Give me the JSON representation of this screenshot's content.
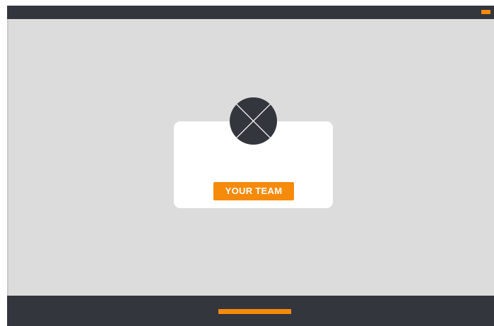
{
  "header": {
    "indicator_color": "#f68a0a",
    "bar_color": "#33363d"
  },
  "card": {
    "avatar_icon": "placeholder-image-icon",
    "button_label": "YOUR TEAM",
    "button_color": "#f68a0a"
  },
  "footer": {
    "indicator_color": "#f68a0a"
  },
  "colors": {
    "background": "#dcdcdc",
    "dark": "#33363d",
    "accent": "#f68a0a",
    "card": "#ffffff"
  }
}
